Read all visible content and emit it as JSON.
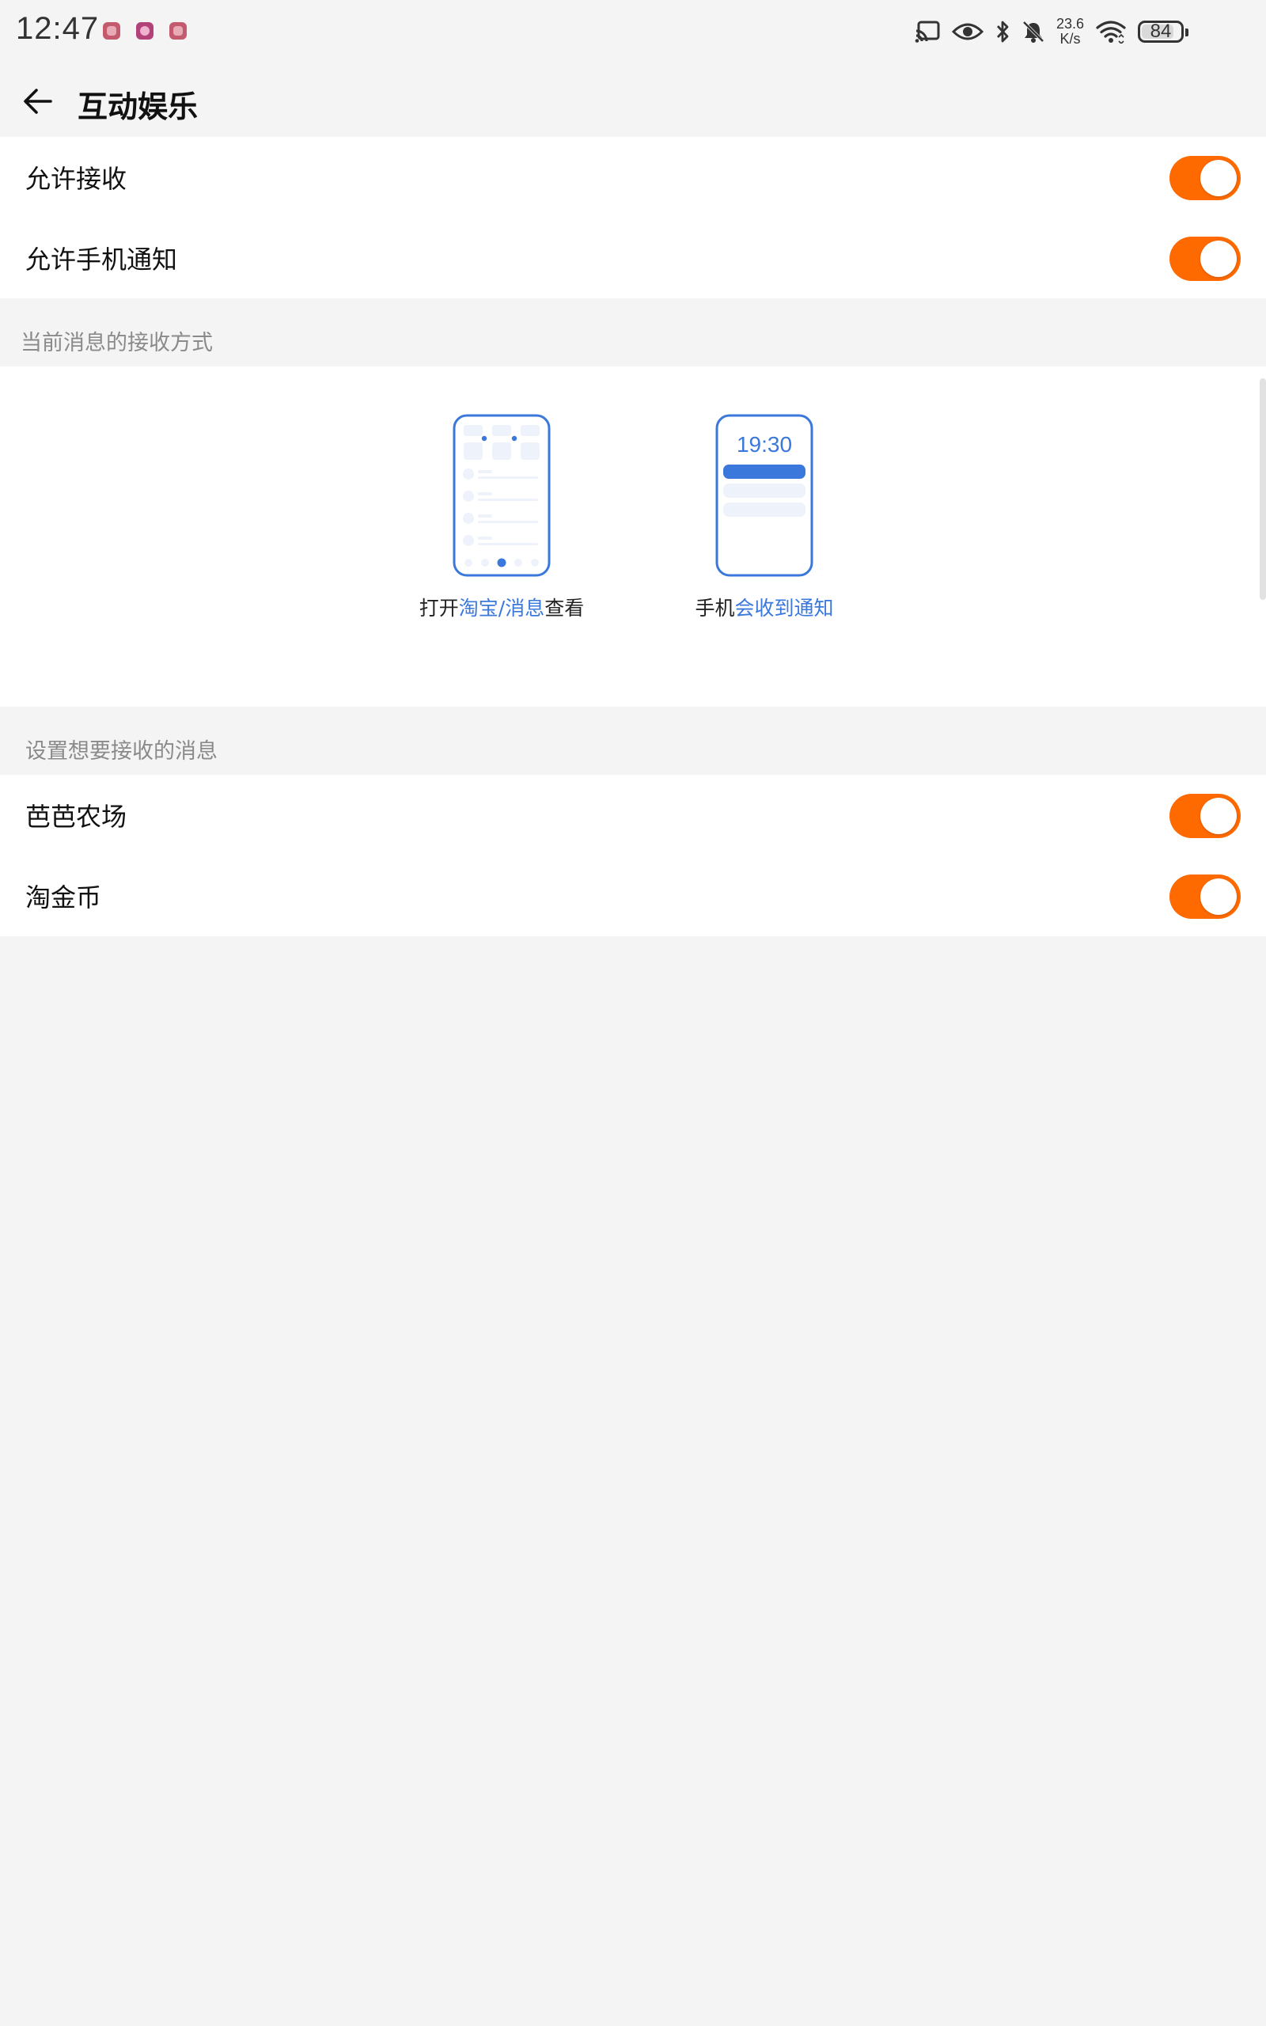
{
  "status_bar": {
    "time": "12:47",
    "notification_icons": [
      "app-notification-icon",
      "app-notification-icon",
      "app-notification-icon"
    ],
    "net_speed_value": "23.6",
    "net_speed_unit": "K/s",
    "battery": "84",
    "battery_level_percent": 84,
    "icons": [
      "cast-icon",
      "eye-comfort-icon",
      "bluetooth-icon",
      "mute-icon",
      "wifi-icon",
      "battery-icon"
    ]
  },
  "header": {
    "title": "互动娱乐",
    "back_icon": "back-arrow-icon"
  },
  "general_settings": [
    {
      "label": "允许接收",
      "enabled": true
    },
    {
      "label": "允许手机通知",
      "enabled": true
    }
  ],
  "receive_mode": {
    "section_title": "当前消息的接收方式",
    "modes": [
      {
        "caption_prefix": "打开",
        "caption_highlight": "淘宝/消息",
        "caption_suffix": "查看"
      },
      {
        "caption_prefix": "手机",
        "caption_highlight": "会收到通知",
        "caption_suffix": "",
        "phone_time": "19:30"
      }
    ]
  },
  "subscriptions": {
    "section_title": "设置想要接收的消息",
    "items": [
      {
        "label": "芭芭农场",
        "enabled": true
      },
      {
        "label": "淘金币",
        "enabled": true
      }
    ]
  },
  "colors": {
    "accent_orange": "#ff6a00",
    "highlight_blue": "#3a78dc",
    "background": "#f4f4f4"
  }
}
